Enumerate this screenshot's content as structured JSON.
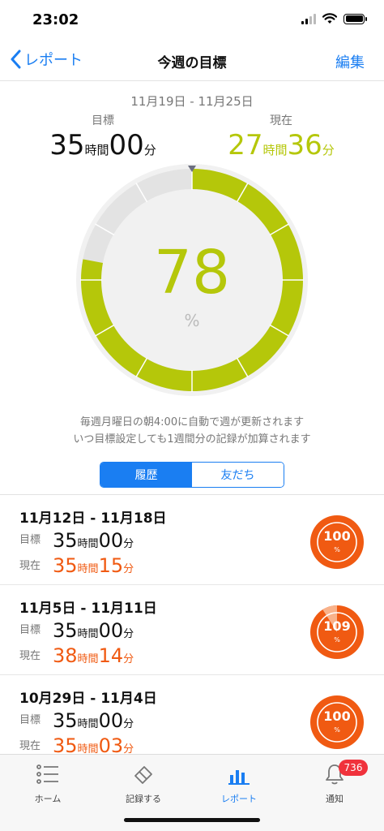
{
  "status": {
    "time": "23:02"
  },
  "nav": {
    "back_label": "レポート",
    "title": "今週の目標",
    "edit_label": "編集"
  },
  "summary": {
    "week_range": "11月19日 - 11月25日",
    "target_label": "目標",
    "target_hours": "35",
    "target_minutes": "00",
    "current_label": "現在",
    "current_hours": "27",
    "current_minutes": "36",
    "hour_unit": "時間",
    "minute_unit": "分",
    "percent": "78",
    "percent_unit": "%",
    "progress_fraction": 0.78,
    "segments": 12
  },
  "notes": {
    "line1": "毎週月曜日の朝4:00に自動で週が更新されます",
    "line2": "いつ目標設定しても1週間分の記録が加算されます"
  },
  "segment_control": {
    "history": "履歴",
    "friends": "友だち"
  },
  "history": [
    {
      "range": "11月12日 - 11月18日",
      "target_label": "目標",
      "target_hours": "35",
      "target_minutes": "00",
      "current_label": "現在",
      "current_hours": "35",
      "current_minutes": "15",
      "percent": "100",
      "percent_unit": "%",
      "fraction": 1.0
    },
    {
      "range": "11月5日 - 11月11日",
      "target_label": "目標",
      "target_hours": "35",
      "target_minutes": "00",
      "current_label": "現在",
      "current_hours": "38",
      "current_minutes": "14",
      "percent": "109",
      "percent_unit": "%",
      "fraction": 0.91
    },
    {
      "range": "10月29日 - 11月4日",
      "target_label": "目標",
      "target_hours": "35",
      "target_minutes": "00",
      "current_label": "現在",
      "current_hours": "35",
      "current_minutes": "03",
      "percent": "100",
      "percent_unit": "%",
      "fraction": 1.0
    }
  ],
  "tabs": {
    "home": "ホーム",
    "record": "記録する",
    "report": "レポート",
    "notify": "通知",
    "notify_badge": "736"
  },
  "colors": {
    "accent_blue": "#1a7ef2",
    "progress_green": "#b5c70a",
    "ring_empty": "#e3e3e3",
    "history_orange": "#f05a12",
    "badge_red": "#f0323c"
  },
  "icons": {
    "back": "chevron-left-icon",
    "home": "list-icon",
    "record": "eraser-icon",
    "report": "bar-chart-icon",
    "notify": "bell-icon"
  }
}
